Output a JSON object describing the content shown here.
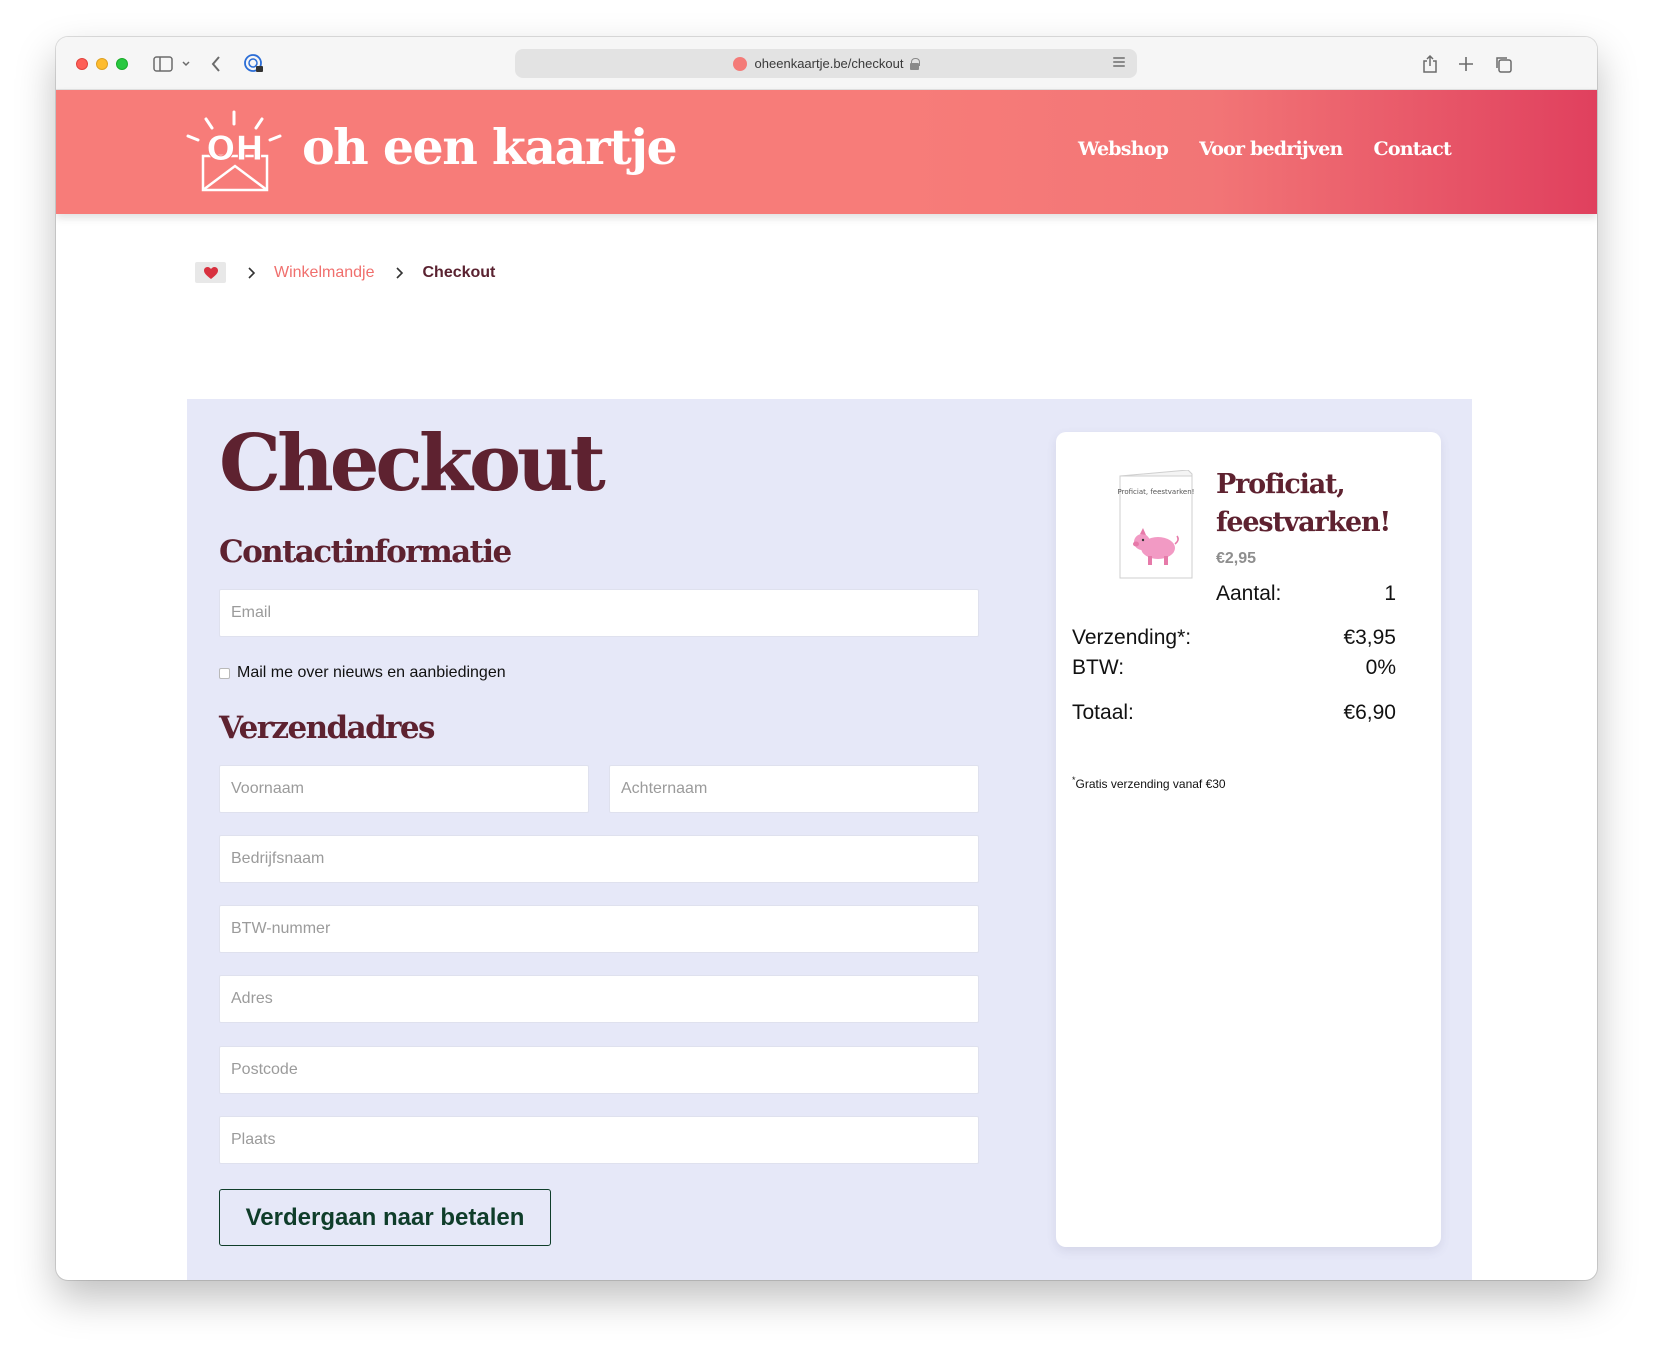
{
  "browser": {
    "url": "oheenkaartje.be/checkout"
  },
  "header": {
    "logo_text": "OH",
    "brand_name": "oh een kaartje",
    "nav": [
      {
        "label": "Webshop"
      },
      {
        "label": "Voor bedrijven"
      },
      {
        "label": "Contact"
      }
    ]
  },
  "breadcrumb": {
    "items": [
      "Winkelmandje",
      "Checkout"
    ]
  },
  "checkout": {
    "title": "Checkout",
    "contact_title": "Contactinformatie",
    "email_placeholder": "Email",
    "newsletter_label": "Mail me over nieuws en aanbiedingen",
    "shipping_title": "Verzendadres",
    "fields": {
      "firstname": "Voornaam",
      "lastname": "Achternaam",
      "company": "Bedrijfsnaam",
      "vat": "BTW-nummer",
      "address": "Adres",
      "postcode": "Postcode",
      "city": "Plaats"
    },
    "pay_button": "Verdergaan naar betalen"
  },
  "summary": {
    "card_text": "Proficiat, feestvarken!",
    "product_name": "Proficiat, feestvarken!",
    "product_price": "€2,95",
    "quantity_label": "Aantal:",
    "quantity_value": "1",
    "shipping_label": "Verzending*:",
    "shipping_value": "€3,95",
    "vat_label": "BTW:",
    "vat_value": "0%",
    "total_label": "Totaal:",
    "total_value": "€6,90",
    "footnote_mark": "*",
    "footnote_text": "Gratis verzending vanaf €30"
  },
  "colors": {
    "header": "#f77c79",
    "accent_dark": "#5e2230",
    "link": "#f06f6d",
    "panel": "#e6e8f8",
    "button": "#0f3d2a"
  }
}
